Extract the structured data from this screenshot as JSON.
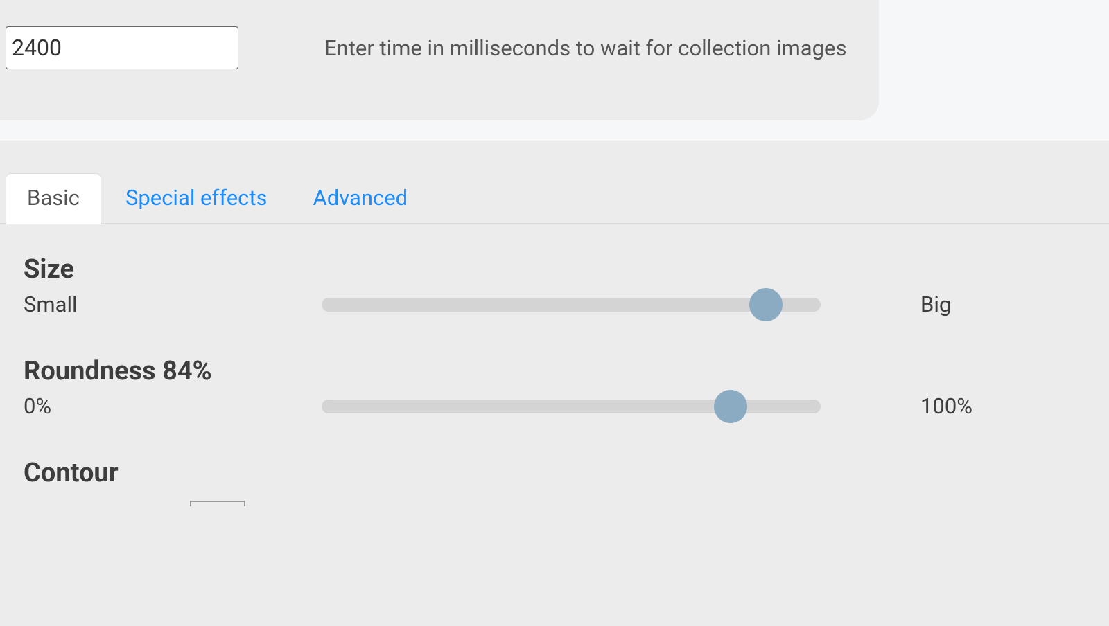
{
  "top": {
    "time_value": "2400",
    "time_hint": "Enter time in milliseconds to wait for collection images"
  },
  "tabs": [
    {
      "label": "Basic",
      "active": true
    },
    {
      "label": "Special effects",
      "active": false
    },
    {
      "label": "Advanced",
      "active": false
    }
  ],
  "settings": {
    "size": {
      "heading": "Size",
      "left_label": "Small",
      "right_label": "Big",
      "value_percent": 89
    },
    "roundness": {
      "heading": "Roundness 84%",
      "left_label": "0%",
      "right_label": "100%",
      "value_percent": 82
    },
    "contour": {
      "heading": "Contour"
    }
  }
}
